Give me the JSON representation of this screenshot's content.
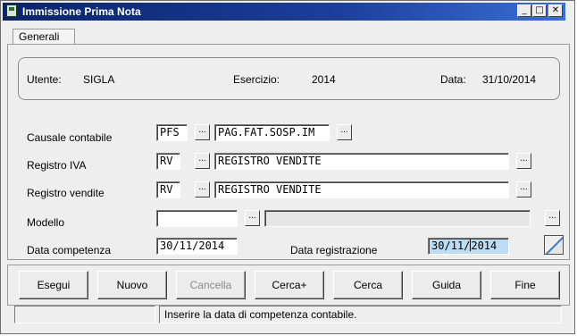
{
  "window": {
    "title": "Immissione Prima Nota",
    "controls": {
      "minimize": "_",
      "maximize": "□",
      "close": "✕"
    }
  },
  "tabs": [
    {
      "label": "Generali"
    }
  ],
  "info": {
    "utente_label": "Utente:",
    "utente_value": "SIGLA",
    "esercizio_label": "Esercizio:",
    "esercizio_value": "2014",
    "data_label": "Data:",
    "data_value": "31/10/2014"
  },
  "form": {
    "causale": {
      "label": "Causale contabile",
      "code": "PFS",
      "description": "PAG.FAT.SOSP.IM"
    },
    "registro_iva": {
      "label": "Registro IVA",
      "code": "RV",
      "description": "REGISTRO VENDITE"
    },
    "registro_vendite": {
      "label": "Registro vendite",
      "code": "RV",
      "description": "REGISTRO VENDITE"
    },
    "modello": {
      "label": "Modello",
      "code": "",
      "description": ""
    },
    "data_competenza": {
      "label": "Data competenza",
      "value": "30/11/2014"
    },
    "data_registrazione": {
      "label": "Data registrazione",
      "value_before_caret": "30/11/",
      "value_after_caret": "2014"
    },
    "lookup_label": "..."
  },
  "buttons": {
    "esegui": "Esegui",
    "nuovo": "Nuovo",
    "cancella": "Cancella",
    "cerca_plus": "Cerca+",
    "cerca": "Cerca",
    "guida": "Guida",
    "fine": "Fine"
  },
  "status": {
    "left": "",
    "message": "Inserire la data di competenza contabile."
  }
}
